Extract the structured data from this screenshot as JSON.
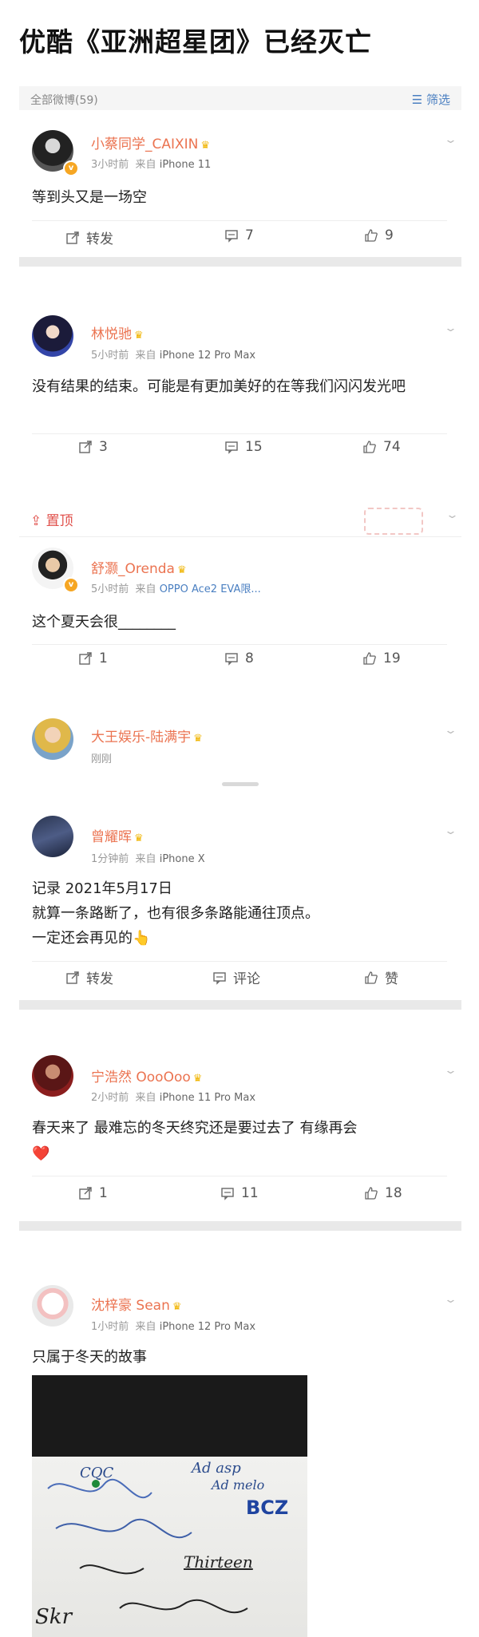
{
  "page": {
    "title": "优酷《亚洲超星团》已经灭亡"
  },
  "header": {
    "count": "全部微博(59)",
    "filter_label": "筛选"
  },
  "posts": [
    {
      "username": "小蔡同学_CAIXIN",
      "time": "3小时前",
      "source_prefix": "来自",
      "source": "iPhone 11",
      "text": "等到头又是一场空",
      "repost": "转发",
      "comment": "7",
      "like": "9"
    },
    {
      "username": "林悦驰",
      "time": "5小时前",
      "source_prefix": "来自",
      "source": "iPhone 12 Pro Max",
      "text": "没有结果的结束。可能是有更加美好的在等我们闪闪发光吧",
      "repost": "3",
      "comment": "15",
      "like": "74"
    },
    {
      "pinned_label": "置顶",
      "username": "舒灏_Orenda",
      "time": "5小时前",
      "source_prefix": "来自",
      "source": "OPPO Ace2 EVA限...",
      "text": "这个夏天会很________",
      "repost": "1",
      "comment": "8",
      "like": "19"
    },
    {
      "username": "大王娱乐-陆满宇",
      "time": "刚刚"
    },
    {
      "username": "曾耀晖",
      "time": "1分钟前",
      "source_prefix": "来自",
      "source": "iPhone X",
      "text_line1": "记录 2021年5月17日",
      "text_line2": "就算一条路断了，也有很多条路能通往顶点。",
      "text_line3": "一定还会再见的👆",
      "repost": "转发",
      "comment": "评论",
      "like": "赞"
    },
    {
      "username": "宁浩然 OooOoo",
      "time": "2小时前",
      "source_prefix": "来自",
      "source": "iPhone 11 Pro Max",
      "text": "春天来了 最难忘的冬天终究还是要过去了 有缘再会",
      "emoji": "❤️",
      "repost": "1",
      "comment": "11",
      "like": "18"
    },
    {
      "username": "沈梓豪 Sean",
      "time": "1小时前",
      "source_prefix": "来自",
      "source": "iPhone 12 Pro Max",
      "text": "只属于冬天的故事"
    }
  ],
  "photo_writing": [
    "CQC",
    "Ad asp",
    "Ad melo",
    "BCZ",
    "Thirteen",
    "Skr"
  ],
  "icons": {
    "filter": "filter-icon",
    "repost": "repost-icon",
    "comment": "comment-icon",
    "like": "like-icon",
    "pin": "pin-icon",
    "verified": "verified-badge-icon",
    "crown": "crown-icon",
    "chevron": "chevron-down-icon"
  },
  "colors": {
    "username": "#eb7350",
    "link_blue": "#4a7fc1",
    "pin_red": "#e0504b",
    "gap": "#e9e9e9"
  }
}
